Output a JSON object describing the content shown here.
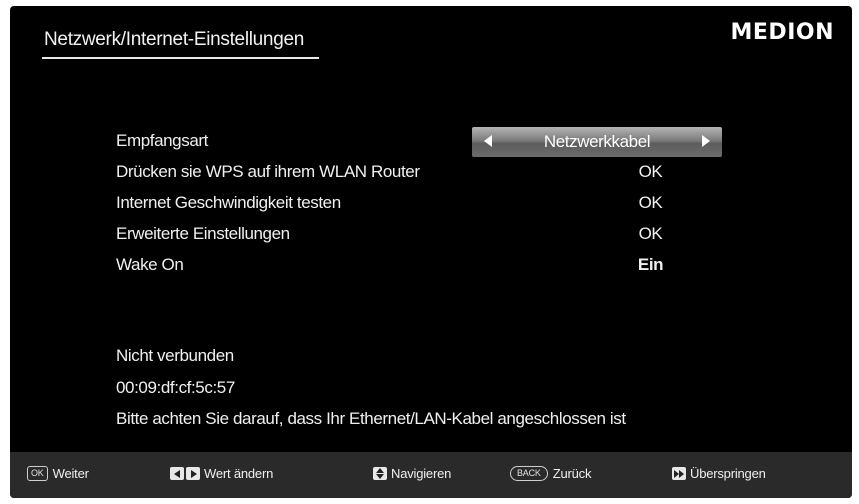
{
  "header": {
    "title": "Netzwerk/Internet-Einstellungen",
    "brand": "MEDION"
  },
  "settings": [
    {
      "label": "Empfangsart",
      "value": "Netzwerkkabel"
    },
    {
      "label": "Drücken sie WPS auf ihrem WLAN Router",
      "value": "OK"
    },
    {
      "label": "Internet Geschwindigkeit testen",
      "value": "OK"
    },
    {
      "label": "Erweiterte Einstellungen",
      "value": "OK"
    },
    {
      "label": "Wake On",
      "value": "Ein"
    }
  ],
  "status": {
    "connection": "Nicht verbunden",
    "mac": "00:09:df:cf:5c:57",
    "hint": "Bitte achten Sie darauf, dass Ihr Ethernet/LAN-Kabel angeschlossen ist"
  },
  "footer": {
    "ok_key": "OK",
    "ok_label": "Weiter",
    "change_label": "Wert ändern",
    "navigate_label": "Navigieren",
    "back_key": "BACK",
    "back_label": "Zurück",
    "skip_label": "Überspringen"
  },
  "icons": [
    "left-arrow-icon",
    "right-arrow-icon",
    "up-down-icon",
    "fast-forward-icon"
  ]
}
